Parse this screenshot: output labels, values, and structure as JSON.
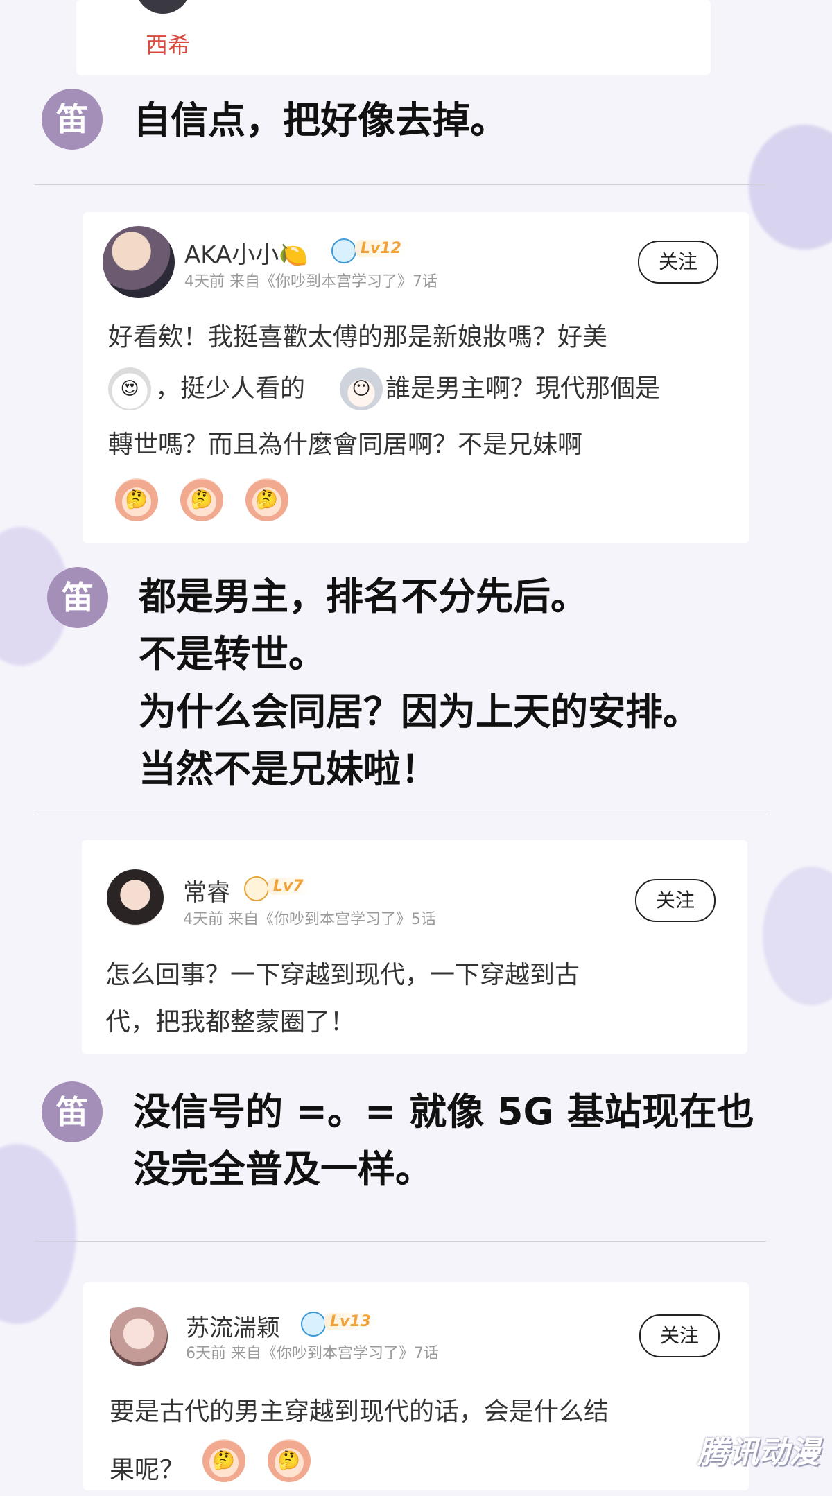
{
  "top": {
    "username": "西希"
  },
  "replies": [
    {
      "badge": "笛",
      "text": "自信点，把好像去掉。"
    },
    {
      "badge": "笛",
      "text": "都是男主，排名不分先后。\n不是转世。\n为什么会同居？因为上天的安排。\n当然不是兄妹啦！"
    },
    {
      "badge": "笛",
      "text": "没信号的 =。= 就像 5G 基站现在也\n没完全普及一样。"
    }
  ],
  "comments": [
    {
      "username": "AKA小小",
      "name_emoji": "🍋",
      "level": "Lv12",
      "meta": "4天前  来自《你吵到本宫学习了》7话",
      "follow": "关注",
      "lines": [
        "好看欸！我挺喜歡太傅的那是新娘妝嗎？好美",
        "，挺少人看的",
        "誰是男主啊？現代那個是",
        "轉世嗎？而且為什麼會同居啊？不是兄妹啊"
      ],
      "emojis": [
        "😍",
        "😶",
        "🤔",
        "🤔",
        "🤔"
      ]
    },
    {
      "username": "常睿",
      "level": "Lv7",
      "meta": "4天前  来自《你吵到本宫学习了》5话",
      "follow": "关注",
      "lines": [
        "怎么回事？一下穿越到现代，一下穿越到古",
        "代，把我都整蒙圈了！"
      ]
    },
    {
      "username": "苏流湍颖",
      "level": "Lv13",
      "meta": "6天前  来自《你吵到本宫学习了》7话",
      "follow": "关注",
      "lines": [
        "要是古代的男主穿越到现代的话，会是什么结",
        "果呢？"
      ],
      "emojis": [
        "🤔",
        "🤔"
      ]
    }
  ],
  "watermark": "腾讯动漫",
  "colors": {
    "badge": "#a48fb9",
    "level": "#f0a238",
    "background": "#f6f4fb"
  }
}
